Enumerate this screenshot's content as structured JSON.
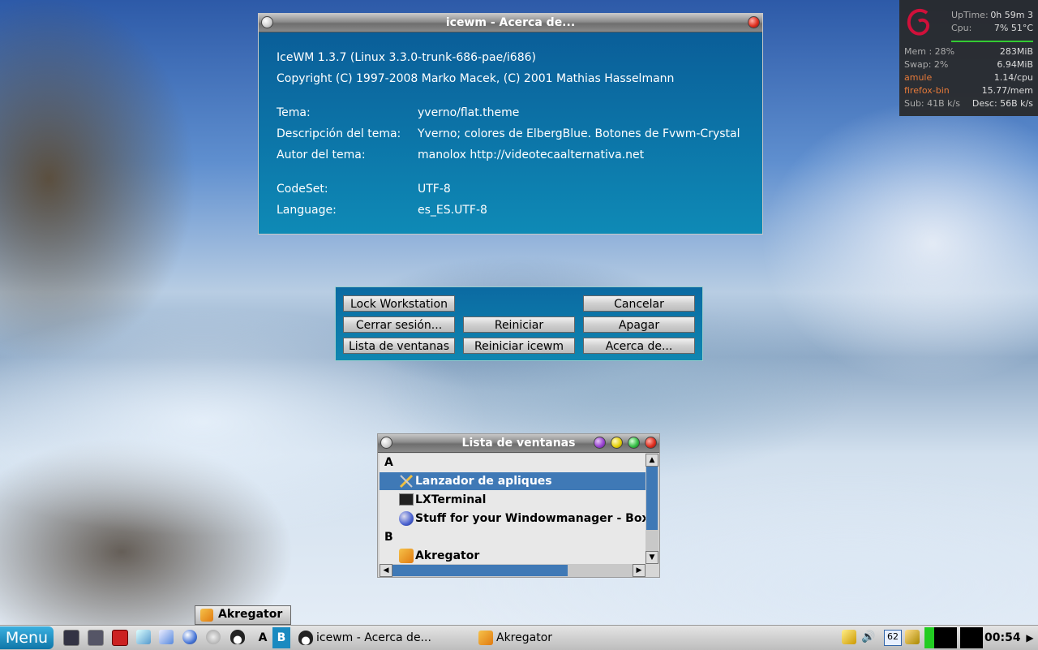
{
  "about": {
    "title": "icewm - Acerca de...",
    "version_line": "IceWM 1.3.7 (Linux 3.3.0-trunk-686-pae/i686)",
    "copyright_line": "Copyright (C) 1997-2008 Marko Macek, (C) 2001 Mathias Hasselmann",
    "fields": [
      {
        "label": "Tema:",
        "value": "yverno/flat.theme"
      },
      {
        "label": "Descripción del tema:",
        "value": "Yverno; colores de ElbergBlue. Botones de Fvwm-Crystal"
      },
      {
        "label": "Autor del tema:",
        "value": "manolox http://videotecaalternativa.net"
      },
      {
        "label": "CodeSet:",
        "value": "UTF-8"
      },
      {
        "label": "Language:",
        "value": "es_ES.UTF-8"
      }
    ]
  },
  "logout": {
    "lock": "Lock Workstation",
    "cancel": "Cancelar",
    "logout": "Cerrar sesión...",
    "reboot": "Reiniciar",
    "shutdown": "Apagar",
    "window_list": "Lista de ventanas",
    "restart_icewm": "Reiniciar icewm",
    "about": "Acerca de..."
  },
  "winlist": {
    "title": "Lista de ventanas",
    "rows": [
      {
        "text": "A"
      },
      {
        "text": "Lanzador de apliques"
      },
      {
        "text": "LXTerminal"
      },
      {
        "text": "Stuff for your Windowmanager - Box-Loo"
      },
      {
        "text": "B"
      },
      {
        "text": "Akregator"
      }
    ]
  },
  "monitor": {
    "uptime_label": "UpTime:",
    "uptime_value": "0h 59m 3",
    "cpu_label": "Cpu:",
    "cpu_value": "7% 51°C",
    "mem_label": "Mem : 28%",
    "mem_value": "283MiB",
    "swap_label": "Swap: 2%",
    "swap_value": "6.94MiB",
    "proc1_name": "amule",
    "proc1_value": "1.14/cpu",
    "proc2_name": "firefox-bin",
    "proc2_value": "15.77/mem",
    "sub_label": "Sub: 41B  k/s",
    "desc_label": "Desc: 56B  k/s"
  },
  "desktop_button": "Akregator",
  "taskbar": {
    "menu": "Menu",
    "ws_a": "A",
    "ws_b": "B",
    "task1": "icewm - Acerca de...",
    "task2": "Akregator",
    "tray_num": "62",
    "clock": "00:54"
  },
  "colors": {
    "about_bg": "#0a5a96",
    "selected_row": "#3f79b6",
    "taskbar_menu": "#1a8ac0"
  }
}
